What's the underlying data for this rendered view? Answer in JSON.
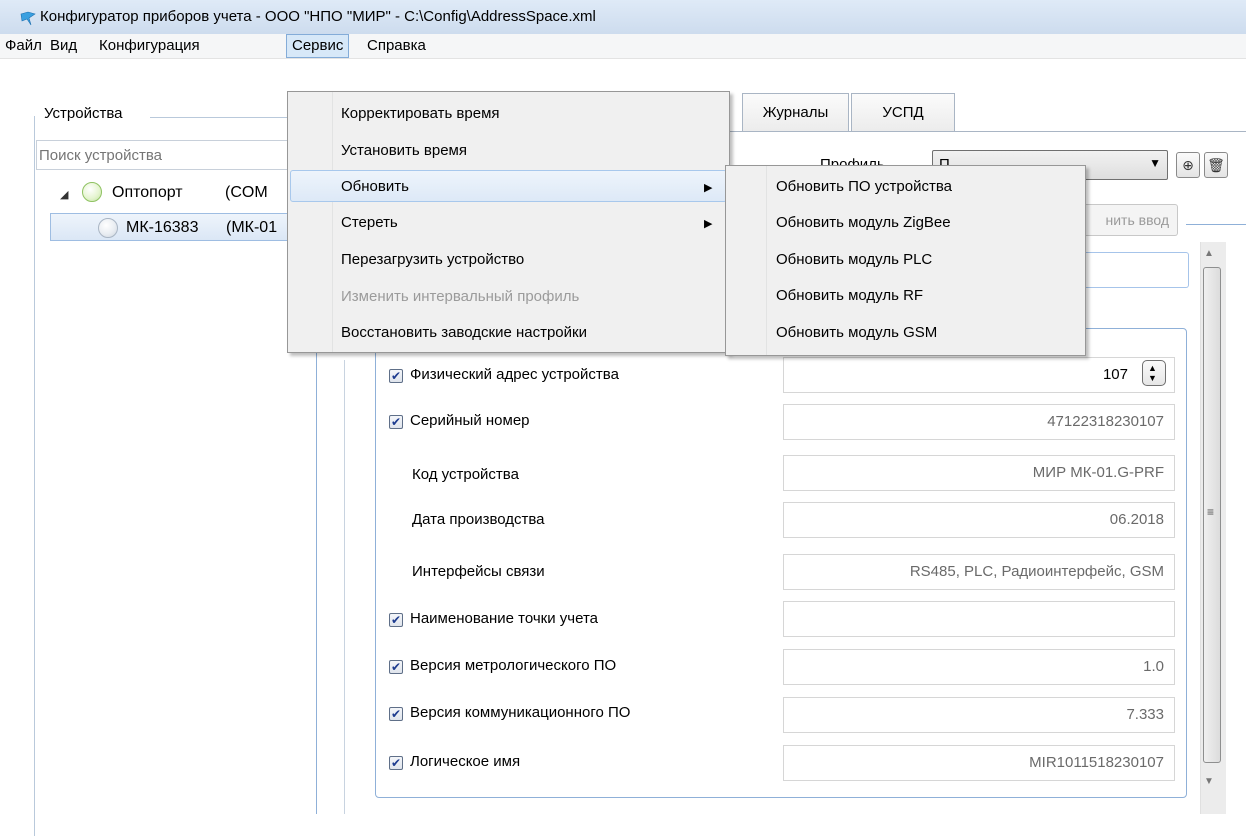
{
  "window": {
    "title": "Конфигуратор приборов учета - ООО \"НПО \"МИР\" - C:\\Config\\AddressSpace.xml"
  },
  "menubar": {
    "items": [
      "Файл",
      "Вид",
      "Конфигурация",
      "Сервис",
      "Справка"
    ],
    "active": "Сервис"
  },
  "devices_panel": {
    "title": "Устройства",
    "search_placeholder": "Поиск устройства",
    "tree": [
      {
        "name": "Оптопорт",
        "port": "(COM",
        "status": "connected",
        "expanded": true
      },
      {
        "name": "МК-16383",
        "model": "(МК-01",
        "status": "idle",
        "selected": true
      }
    ]
  },
  "tabs": [
    "Журналы",
    "УСПД"
  ],
  "profile": {
    "label": "Профиль",
    "selected": "П"
  },
  "toolbar": {
    "apply_input_label": "нить ввод"
  },
  "properties": [
    {
      "checked": true,
      "label": "Физический адрес устройства",
      "value": "107",
      "editable": true
    },
    {
      "checked": true,
      "label": "Серийный номер",
      "value": "47122318230107"
    },
    {
      "checked": null,
      "label": "Код устройства",
      "value": "МИР МК-01.G-PRF"
    },
    {
      "checked": null,
      "label": "Дата производства",
      "value": "06.2018"
    },
    {
      "checked": null,
      "label": "Интерфейсы связи",
      "value": "RS485, PLC, Радиоинтерфейс, GSM"
    },
    {
      "checked": true,
      "label": "Наименование точки учета",
      "value": ""
    },
    {
      "checked": true,
      "label": "Версия метрологического ПО",
      "value": "1.0"
    },
    {
      "checked": true,
      "label": "Версия коммуникационного ПО",
      "value": "7.333"
    },
    {
      "checked": true,
      "label": "Логическое имя",
      "value": "MIR1011518230107"
    }
  ],
  "service_menu": {
    "items": [
      {
        "label": "Корректировать время",
        "enabled": true,
        "submenu": false
      },
      {
        "label": "Установить время",
        "enabled": true,
        "submenu": false
      },
      {
        "label": "Обновить",
        "enabled": true,
        "submenu": true,
        "highlighted": true
      },
      {
        "label": "Стереть",
        "enabled": true,
        "submenu": true
      },
      {
        "label": "Перезагрузить устройство",
        "enabled": true,
        "submenu": false
      },
      {
        "label": "Изменить интервальный профиль",
        "enabled": false,
        "submenu": false
      },
      {
        "label": "Восстановить заводские настройки",
        "enabled": true,
        "submenu": false
      }
    ]
  },
  "update_submenu": {
    "items": [
      "Обновить ПО устройства",
      "Обновить модуль ZigBee",
      "Обновить модуль PLC",
      "Обновить модуль RF",
      "Обновить модуль GSM"
    ]
  },
  "colors": {
    "menu_highlight": "#d7e8f8",
    "frame_border": "#8fb0d8",
    "status_connected": "#8fc262"
  },
  "icons": [
    "app-icon",
    "add-profile-icon",
    "delete-profile-icon",
    "dropdown-arrow-icon",
    "submenu-arrow-icon",
    "expand-collapse-icon",
    "checkbox-icon",
    "spinner-up-icon",
    "spinner-down-icon"
  ]
}
